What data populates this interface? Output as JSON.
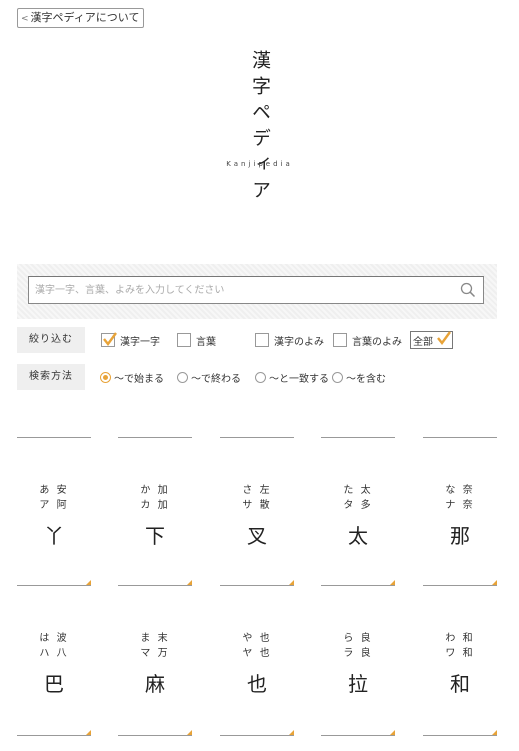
{
  "about_link": "漢字ペディアについて",
  "logo": {
    "title": "漢字ペディア",
    "subtitle": "Kanjipedia"
  },
  "search": {
    "placeholder": "漢字一字、言葉、よみを入力してください",
    "value": ""
  },
  "filter": {
    "label": "絞り込む",
    "options": [
      {
        "label": "漢字一字",
        "checked": true
      },
      {
        "label": "言葉",
        "checked": false
      },
      {
        "label": "漢字のよみ",
        "checked": false
      },
      {
        "label": "言葉のよみ",
        "checked": false
      }
    ],
    "all_label": "全部",
    "all_checked": true
  },
  "method": {
    "label": "検索方法",
    "options": [
      {
        "label": "〜で始まる",
        "selected": true
      },
      {
        "label": "〜で終わる",
        "selected": false
      },
      {
        "label": "〜と一致する",
        "selected": false
      },
      {
        "label": "〜を含む",
        "selected": false
      }
    ]
  },
  "accent_color": "#e8a338",
  "kana_grid": [
    {
      "hira": "あ 安",
      "kata": "ア 阿",
      "kanji": "丫"
    },
    {
      "hira": "か 加",
      "kata": "カ 加",
      "kanji": "下"
    },
    {
      "hira": "さ 左",
      "kata": "サ 散",
      "kanji": "叉"
    },
    {
      "hira": "た 太",
      "kata": "タ 多",
      "kanji": "太"
    },
    {
      "hira": "な 奈",
      "kata": "ナ 奈",
      "kanji": "那"
    },
    {
      "hira": "は 波",
      "kata": "ハ 八",
      "kanji": "巴"
    },
    {
      "hira": "ま 末",
      "kata": "マ 万",
      "kanji": "麻"
    },
    {
      "hira": "や 也",
      "kata": "ヤ 也",
      "kanji": "也"
    },
    {
      "hira": "ら 良",
      "kata": "ラ 良",
      "kanji": "拉"
    },
    {
      "hira": "わ 和",
      "kata": "ワ 和",
      "kanji": "和"
    }
  ]
}
